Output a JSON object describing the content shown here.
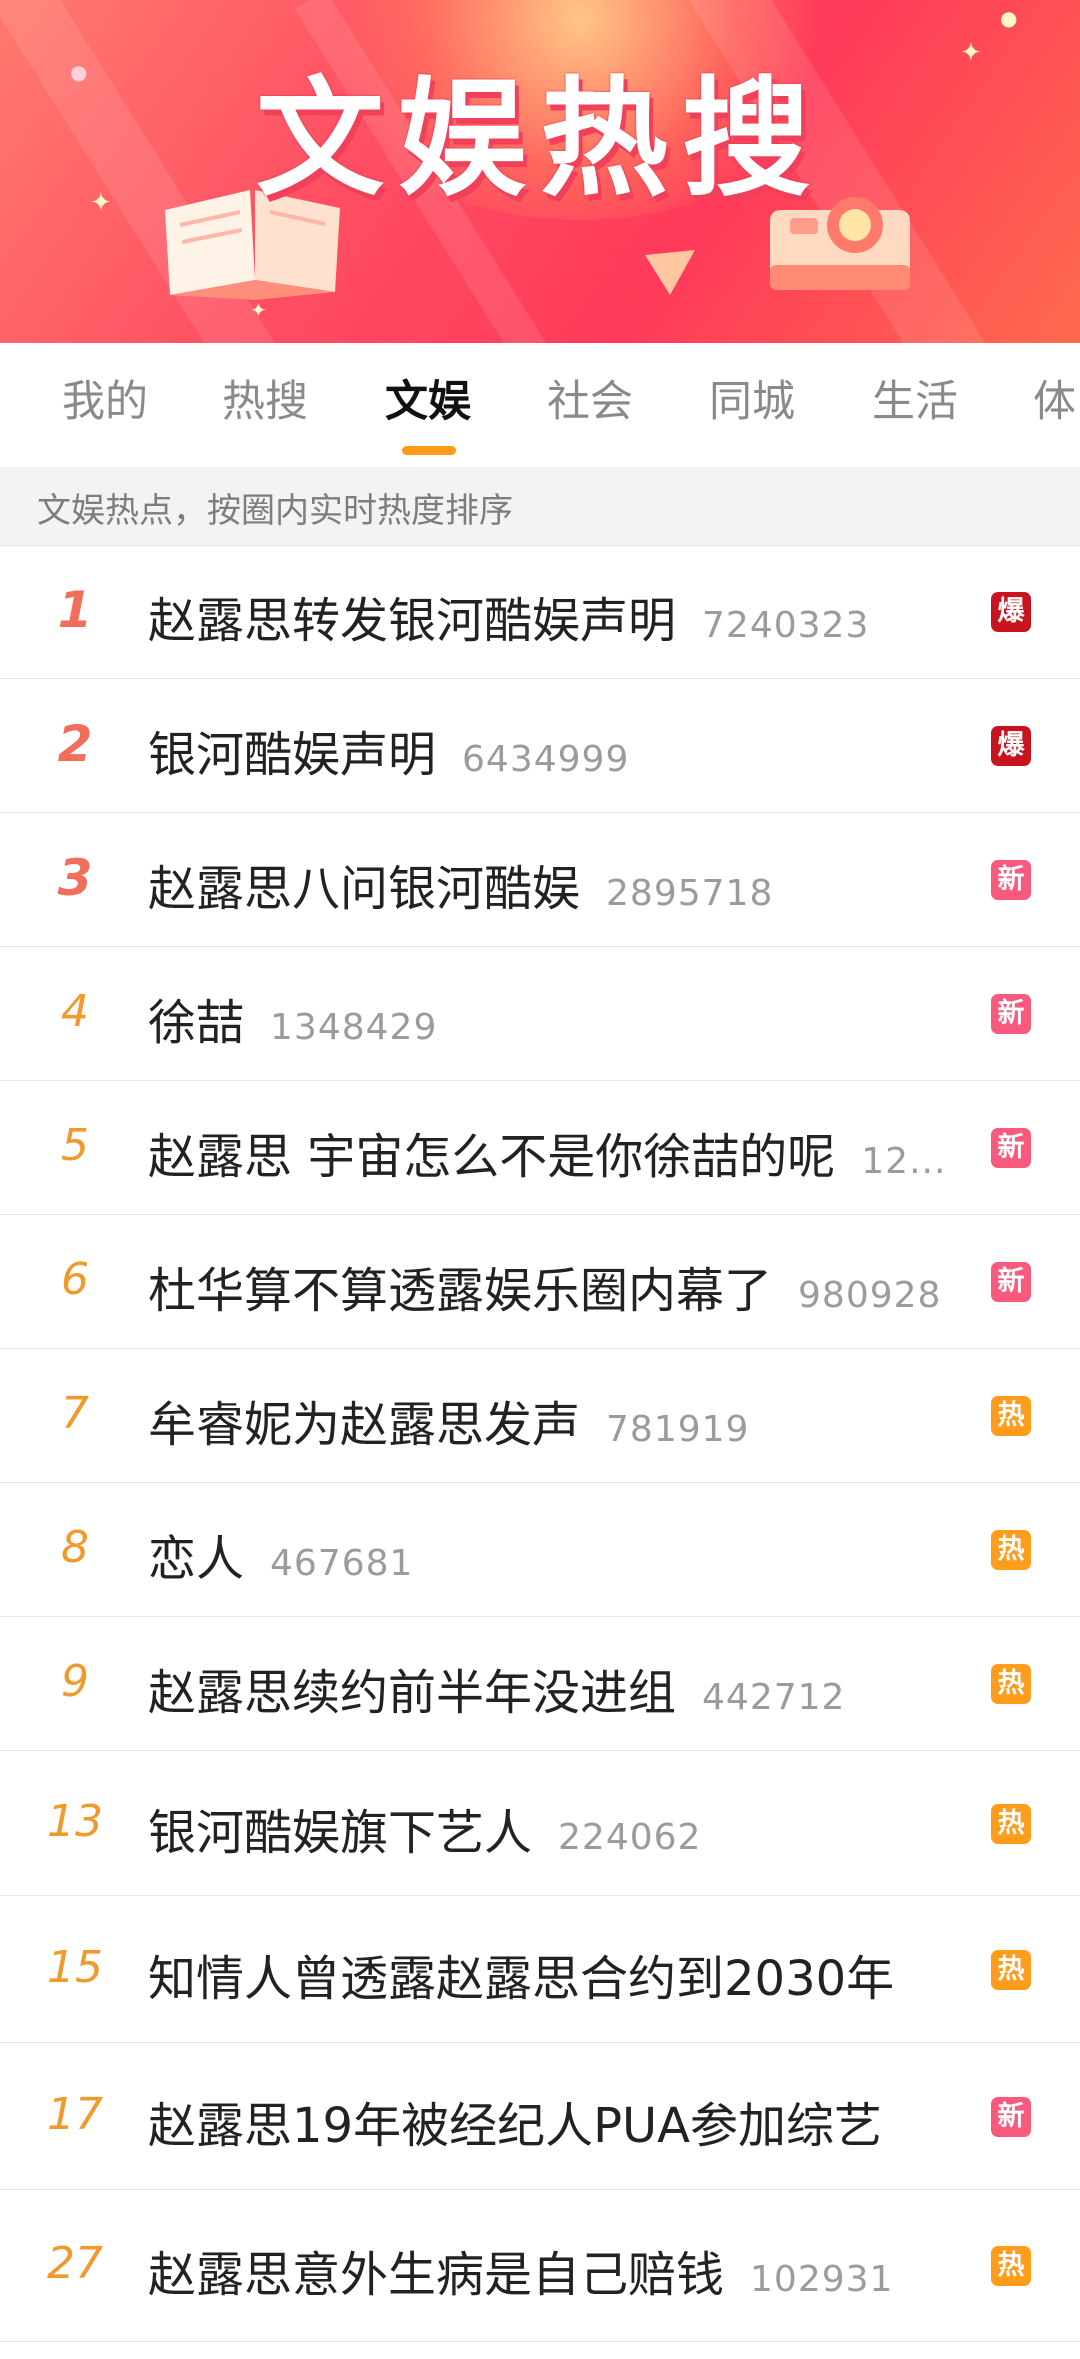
{
  "banner": {
    "title": "文娱热搜",
    "colors": {
      "gradient_start": "#ff7a6e",
      "gradient_end": "#ff3a5a"
    }
  },
  "tabs": [
    {
      "label": "我的",
      "active": false
    },
    {
      "label": "热搜",
      "active": false
    },
    {
      "label": "文娱",
      "active": true
    },
    {
      "label": "社会",
      "active": false
    },
    {
      "label": "同城",
      "active": false
    },
    {
      "label": "生活",
      "active": false
    },
    {
      "label": "体",
      "active": false
    }
  ],
  "subtitle": "文娱热点，按圈内实时热度排序",
  "badge_colors": {
    "爆": "#c8141e",
    "新": "#f85a7e",
    "热": "#ff9c1c"
  },
  "items": [
    {
      "rank": "1",
      "title": "赵露思转发银河酷娱声明",
      "count": "7240323",
      "badge": "爆"
    },
    {
      "rank": "2",
      "title": "银河酷娱声明",
      "count": "6434999",
      "badge": "爆"
    },
    {
      "rank": "3",
      "title": "赵露思八问银河酷娱",
      "count": "2895718",
      "badge": "新"
    },
    {
      "rank": "4",
      "title": "徐喆",
      "count": "1348429",
      "badge": "新"
    },
    {
      "rank": "5",
      "title": "赵露思 宇宙怎么不是你徐喆的呢",
      "count": "12...",
      "badge": "新"
    },
    {
      "rank": "6",
      "title": "杜华算不算透露娱乐圈内幕了",
      "count": "980928",
      "badge": "新"
    },
    {
      "rank": "7",
      "title": "牟睿妮为赵露思发声",
      "count": "781919",
      "badge": "热"
    },
    {
      "rank": "8",
      "title": "恋人",
      "count": "467681",
      "badge": "热"
    },
    {
      "rank": "9",
      "title": "赵露思续约前半年没进组",
      "count": "442712",
      "badge": "热"
    },
    {
      "rank": "13",
      "title": "银河酷娱旗下艺人",
      "count": "224062",
      "badge": "热"
    },
    {
      "rank": "15",
      "title": "知情人曾透露赵露思合约到2030年",
      "count": "",
      "badge": "热"
    },
    {
      "rank": "17",
      "title": "赵露思19年被经纪人PUA参加综艺",
      "count": "",
      "badge": "新"
    },
    {
      "rank": "27",
      "title": "赵露思意外生病是自己赔钱",
      "count": "102931",
      "badge": "热"
    }
  ]
}
